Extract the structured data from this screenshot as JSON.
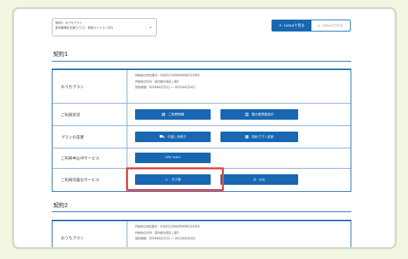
{
  "dropdown": {
    "line1": "契約1：おうちプラン",
    "line2": "東京都港区芝浦〇-〇-〇　駅前マンション101"
  },
  "view_toggle": {
    "active": "Loocaで見る",
    "inactive": "Loocaでみる"
  },
  "contract1": {
    "title": "契約1",
    "plan_label": "おうちプラン",
    "plan_info": [
      "供給地点特定番号：0300111000000000123456",
      "供給地点住所：東京都台東区上野2",
      "契約期間：2019年8月25日 〜 2021年8月24日"
    ],
    "usage_label": "ご利用状況",
    "usage_buttons": [
      "ご利用明細",
      "電力使用量表示"
    ],
    "plan_change_label": "プランの変更",
    "plan_change_buttons": [
      "引越し手続き",
      "契約プラン変更"
    ],
    "applying_label": "ご利用申込中サービス",
    "applying_button": "info more",
    "available_label": "ご利用可能なサービス",
    "available_buttons": [
      "ガス割",
      "火災"
    ]
  },
  "contract2": {
    "title": "契約2",
    "plan_label": "おうちプラン",
    "plan_info": [
      "供給地点特定番号：0300111000000000123456",
      "供給地点住所：東京都台東区上野2",
      "契約期間：2019年8月25日 〜 2021年8月24日"
    ]
  },
  "icons": {
    "dropdown": "chevron-down-icon",
    "usage": [
      "document-icon",
      "chart-icon"
    ],
    "plan_change": [
      "truck-icon",
      "clipboard-icon"
    ],
    "available": [
      "gas-icon",
      "house-icon"
    ],
    "toggle": [
      "lightbulb-icon",
      "home-icon"
    ]
  },
  "colors": {
    "accent": "#1767b3",
    "highlight": "#e05050",
    "background": "#f2f7e1"
  }
}
